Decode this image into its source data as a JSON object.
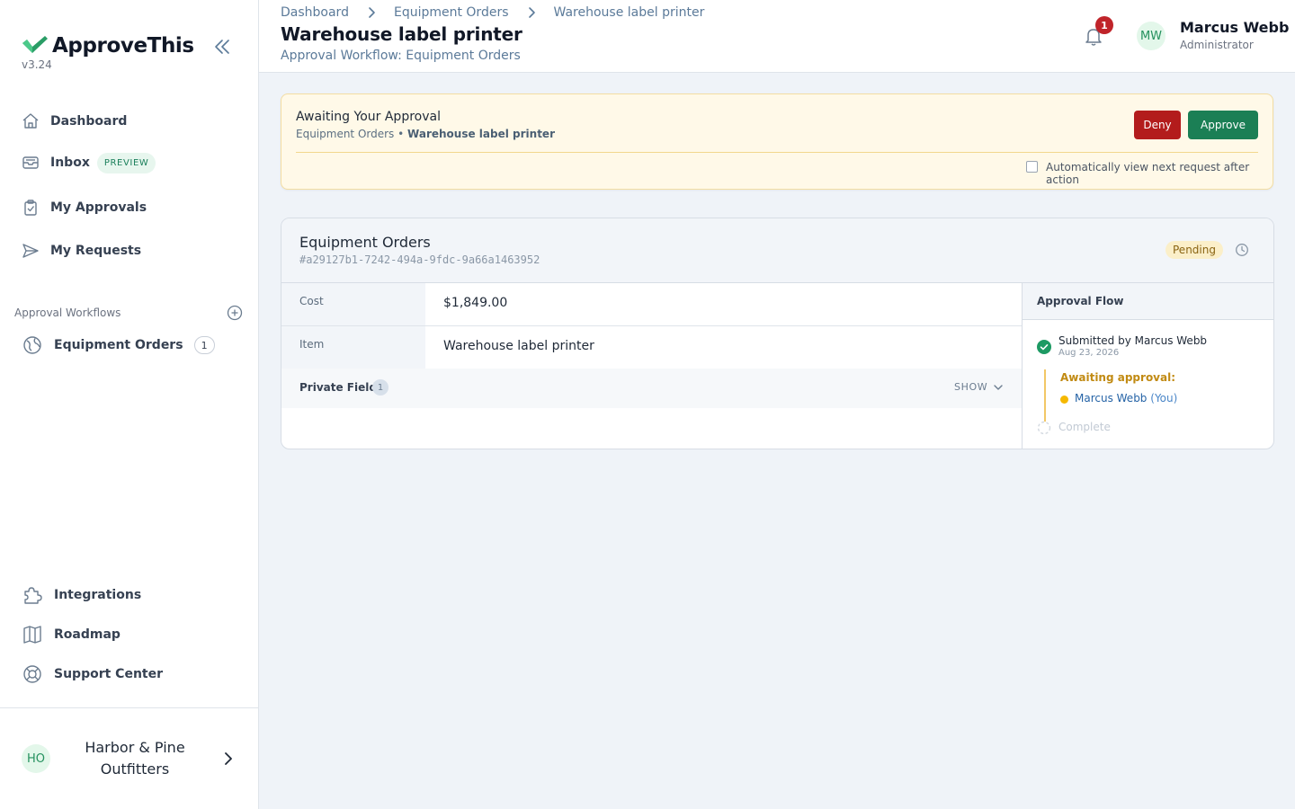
{
  "app": {
    "name": "ApproveThis",
    "version": "v3.24",
    "brand_color": "#2a9d66"
  },
  "sidebar": {
    "nav": [
      {
        "label": "Dashboard",
        "icon": "home-icon"
      },
      {
        "label": "Inbox",
        "icon": "inbox-icon",
        "badge": "PREVIEW"
      },
      {
        "label": "My Approvals",
        "icon": "clipboard-check-icon"
      },
      {
        "label": "My Requests",
        "icon": "send-icon"
      }
    ],
    "workflows_label": "Approval Workflows",
    "workflows": [
      {
        "label": "Equipment Orders",
        "icon": "globe-icon",
        "count": "1"
      }
    ],
    "footer_nav": [
      {
        "label": "Integrations",
        "icon": "puzzle-icon"
      },
      {
        "label": "Roadmap",
        "icon": "map-icon"
      },
      {
        "label": "Support Center",
        "icon": "lifebuoy-icon"
      }
    ],
    "org": {
      "initials": "HO",
      "name": "Harbor & Pine Outfitters"
    }
  },
  "header": {
    "breadcrumb": [
      "Dashboard",
      "Equipment Orders",
      "Warehouse label printer"
    ],
    "title": "Warehouse label printer",
    "subtitle": "Approval Workflow: Equipment Orders",
    "notification_count": "1",
    "user": {
      "initials": "MW",
      "name": "Marcus Webb",
      "role": "Administrator"
    }
  },
  "banner": {
    "title": "Awaiting Your Approval",
    "workflow": "Equipment Orders",
    "separator": "•",
    "request": "Warehouse label printer",
    "deny_label": "Deny",
    "approve_label": "Approve",
    "auto_next_label": "Automatically view next request after action",
    "auto_next_checked": false
  },
  "request": {
    "workflow": "Equipment Orders",
    "id": "#a29127b1-7242-494a-9fdc-9a66a1463952",
    "status": "Pending",
    "fields": [
      {
        "label": "Cost",
        "value": "$1,849.00"
      },
      {
        "label": "Item",
        "value": "Warehouse label printer"
      }
    ],
    "private_fields_label": "Private Fields",
    "private_fields_count": "1",
    "show_label": "SHOW"
  },
  "approval_flow": {
    "title": "Approval Flow",
    "submitted": "Submitted by Marcus Webb",
    "submitted_date": "Aug 23, 2026",
    "awaiting_label": "Awaiting approval:",
    "approver": "Marcus Webb",
    "approver_suffix": "(You)",
    "complete_label": "Complete"
  }
}
